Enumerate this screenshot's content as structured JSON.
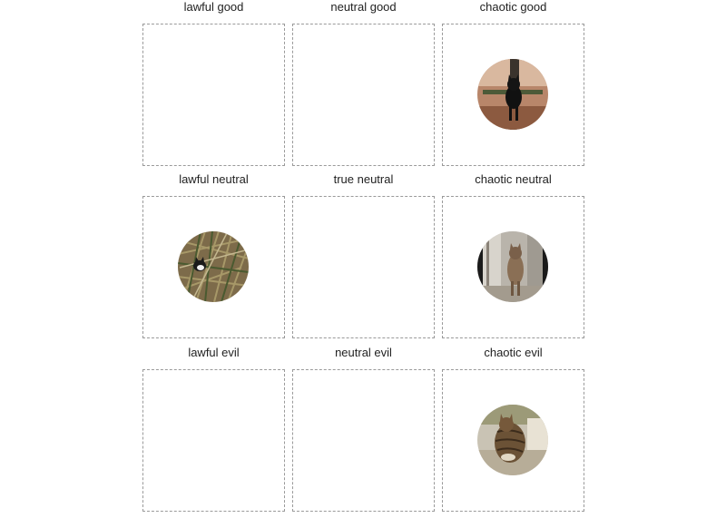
{
  "grid": {
    "cells": [
      {
        "label": "lawful good"
      },
      {
        "label": "neutral good"
      },
      {
        "label": "chaotic good",
        "item": "black-cat-photo"
      },
      {
        "label": "lawful neutral",
        "item": "cat-in-grass-photo"
      },
      {
        "label": "true neutral"
      },
      {
        "label": "chaotic neutral",
        "item": "standing-tabby-cat-photo"
      },
      {
        "label": "lawful evil"
      },
      {
        "label": "neutral evil"
      },
      {
        "label": "chaotic evil",
        "item": "lounging-tabby-cat-photo"
      }
    ]
  }
}
